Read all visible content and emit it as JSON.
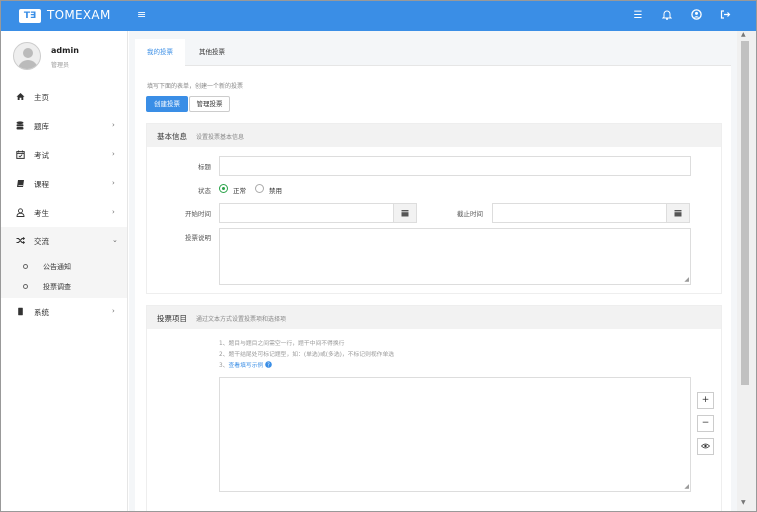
{
  "app": {
    "logo_text": "T∃",
    "brand": "TOMEXAM",
    "menu_icon": "≡"
  },
  "topbar": {
    "icons": [
      "list-icon",
      "bell-icon",
      "user-circle-icon",
      "logout-icon"
    ],
    "glyphs": [
      "☰",
      "🔔",
      "◉",
      "↦"
    ]
  },
  "user": {
    "name": "admin",
    "role": "管理员"
  },
  "nav": [
    {
      "label": "主页",
      "icon": "home-icon",
      "glyph": "⌂",
      "chevron": ""
    },
    {
      "label": "题库",
      "icon": "database-icon",
      "glyph": "≣",
      "chevron": "›"
    },
    {
      "label": "考试",
      "icon": "calendar-icon",
      "glyph": "▦",
      "chevron": "›"
    },
    {
      "label": "课程",
      "icon": "book-icon",
      "glyph": "▰",
      "chevron": "›"
    },
    {
      "label": "考生",
      "icon": "user-icon",
      "glyph": "♙",
      "chevron": "›"
    },
    {
      "label": "交流",
      "icon": "shuffle-icon",
      "glyph": "⤨",
      "chevron": "⌄"
    },
    {
      "label": "系统",
      "icon": "system-icon",
      "glyph": "▮",
      "chevron": "›"
    }
  ],
  "subnav": [
    {
      "label": "公告通知"
    },
    {
      "label": "投票调查"
    }
  ],
  "tabs": {
    "mine": "我的投票",
    "other": "其他投票"
  },
  "hint": "填写下面的表单，创建一个新的投票",
  "buttons": {
    "create": "创建投票",
    "manage": "管理投票"
  },
  "basic": {
    "title": "基本信息",
    "subtitle": "设置投票基本信息",
    "label_title": "标题",
    "label_status": "状态",
    "status_on": "正常",
    "status_off": "禁用",
    "label_start": "开始时间",
    "label_end": "截止时间",
    "label_desc": "投票说明",
    "calendar_glyph": "▦"
  },
  "items": {
    "title": "投票项目",
    "subtitle": "通过文本方式设置投票项和选择项",
    "line1": "1、题目与题目之间需空一行，题干中间不得换行",
    "line2": "2、题干结尾处可标记题型，如：(单选)或(多选)，不标记则视作单选",
    "line3": "3、",
    "line3_link": "查看填写示例",
    "line3_icon": "❓",
    "btn_add": "+",
    "btn_remove": "−",
    "btn_preview": "◉"
  },
  "scroll": {
    "up": "▲",
    "down": "▼"
  }
}
